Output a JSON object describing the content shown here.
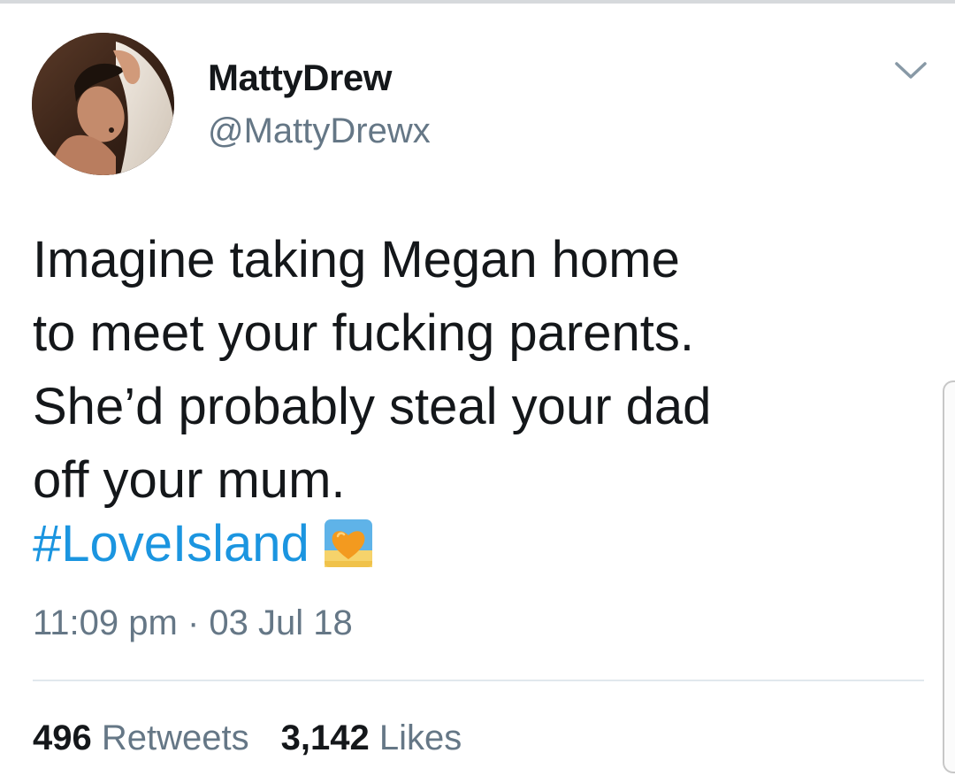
{
  "user": {
    "display_name": "MattyDrew",
    "handle": "@MattyDrewx",
    "avatar_icon": "profile-photo"
  },
  "tweet": {
    "lines": [
      "Imagine taking Megan home",
      "to meet your fucking parents.",
      "She’d probably steal your dad",
      "off your mum."
    ],
    "hashtag": "#LoveIsland",
    "hashflag_icon": "love-island-heart-hashflag",
    "time": "11:09 pm",
    "separator": "·",
    "date": "03 Jul 18"
  },
  "stats": {
    "retweets_count": "496",
    "retweets_label": "Retweets",
    "likes_count": "3,142",
    "likes_label": "Likes"
  },
  "colors": {
    "text": "#14171a",
    "secondary": "#657786",
    "link": "#1b95e0",
    "divider": "#e1e8ed"
  }
}
